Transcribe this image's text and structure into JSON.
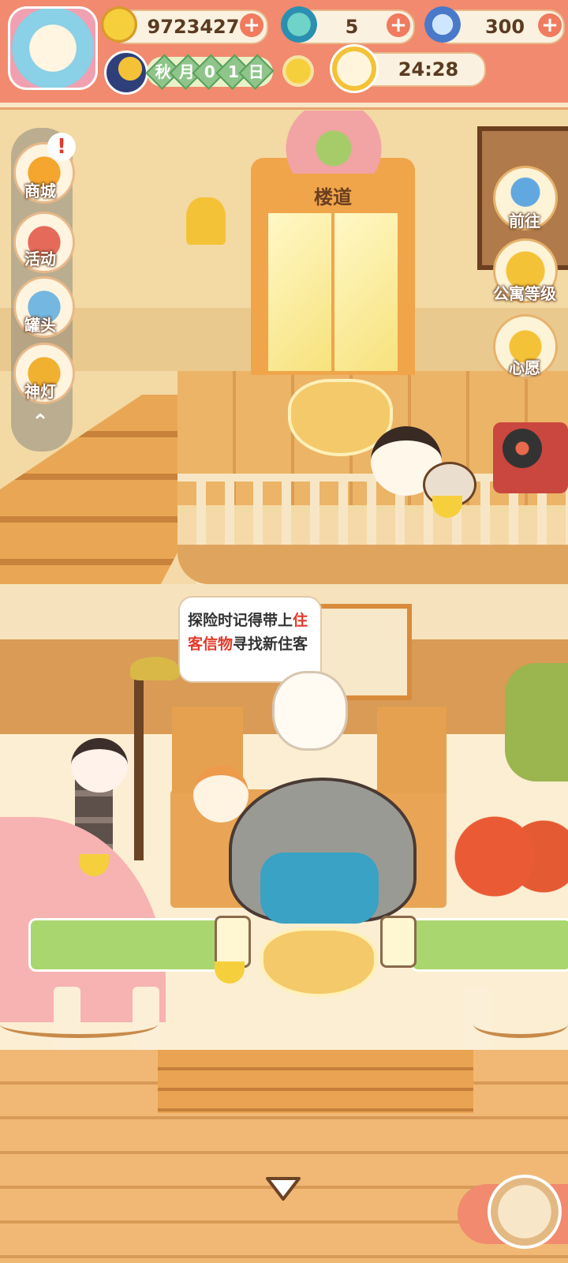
{
  "resources": {
    "bananas": "9723427",
    "flame": "5",
    "gem_banana": "300"
  },
  "calendar": {
    "season": "秋",
    "month_char": "月",
    "day_digit1": "0",
    "day_digit2": "1",
    "day_char": "日"
  },
  "timer": "24:28",
  "left_menu": [
    {
      "label": "商城",
      "icon": "shop-icon",
      "badge": "!"
    },
    {
      "label": "活动",
      "icon": "gift-icon"
    },
    {
      "label": "罐头",
      "icon": "can-icon"
    },
    {
      "label": "神灯",
      "icon": "lamp-icon"
    }
  ],
  "right_menu": [
    {
      "label": "前往",
      "icon": "map-pin-icon"
    },
    {
      "label": "公寓等级",
      "icon": "cat-medal-icon"
    },
    {
      "label": "心愿",
      "icon": "heart-book-icon"
    }
  ],
  "door_sign": "楼道",
  "speech": {
    "part1": "探险时记得带上",
    "highlight": "住客信物",
    "part2": "寻找新住客"
  },
  "colors": {
    "top_bar": "#f18a6e",
    "highlight_text": "#e23a2a",
    "wall": "#f3d9a4",
    "wood": "#e8a95a"
  }
}
